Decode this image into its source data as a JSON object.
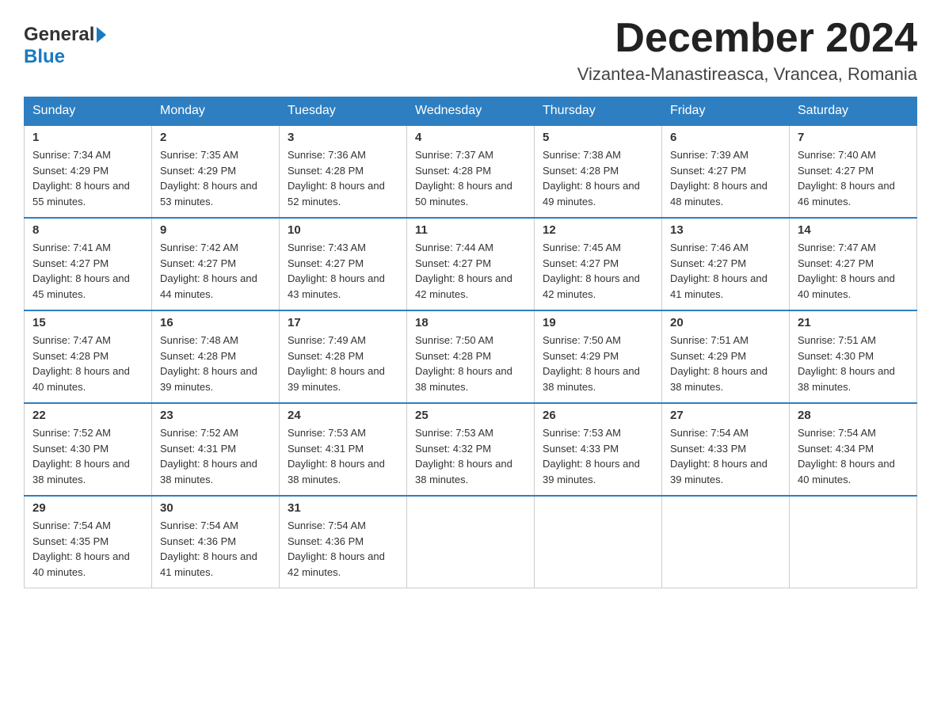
{
  "logo": {
    "general": "General",
    "blue": "Blue"
  },
  "title": "December 2024",
  "subtitle": "Vizantea-Manastireasca, Vrancea, Romania",
  "weekdays": [
    "Sunday",
    "Monday",
    "Tuesday",
    "Wednesday",
    "Thursday",
    "Friday",
    "Saturday"
  ],
  "weeks": [
    [
      {
        "day": "1",
        "sunrise": "7:34 AM",
        "sunset": "4:29 PM",
        "daylight": "8 hours and 55 minutes."
      },
      {
        "day": "2",
        "sunrise": "7:35 AM",
        "sunset": "4:29 PM",
        "daylight": "8 hours and 53 minutes."
      },
      {
        "day": "3",
        "sunrise": "7:36 AM",
        "sunset": "4:28 PM",
        "daylight": "8 hours and 52 minutes."
      },
      {
        "day": "4",
        "sunrise": "7:37 AM",
        "sunset": "4:28 PM",
        "daylight": "8 hours and 50 minutes."
      },
      {
        "day": "5",
        "sunrise": "7:38 AM",
        "sunset": "4:28 PM",
        "daylight": "8 hours and 49 minutes."
      },
      {
        "day": "6",
        "sunrise": "7:39 AM",
        "sunset": "4:27 PM",
        "daylight": "8 hours and 48 minutes."
      },
      {
        "day": "7",
        "sunrise": "7:40 AM",
        "sunset": "4:27 PM",
        "daylight": "8 hours and 46 minutes."
      }
    ],
    [
      {
        "day": "8",
        "sunrise": "7:41 AM",
        "sunset": "4:27 PM",
        "daylight": "8 hours and 45 minutes."
      },
      {
        "day": "9",
        "sunrise": "7:42 AM",
        "sunset": "4:27 PM",
        "daylight": "8 hours and 44 minutes."
      },
      {
        "day": "10",
        "sunrise": "7:43 AM",
        "sunset": "4:27 PM",
        "daylight": "8 hours and 43 minutes."
      },
      {
        "day": "11",
        "sunrise": "7:44 AM",
        "sunset": "4:27 PM",
        "daylight": "8 hours and 42 minutes."
      },
      {
        "day": "12",
        "sunrise": "7:45 AM",
        "sunset": "4:27 PM",
        "daylight": "8 hours and 42 minutes."
      },
      {
        "day": "13",
        "sunrise": "7:46 AM",
        "sunset": "4:27 PM",
        "daylight": "8 hours and 41 minutes."
      },
      {
        "day": "14",
        "sunrise": "7:47 AM",
        "sunset": "4:27 PM",
        "daylight": "8 hours and 40 minutes."
      }
    ],
    [
      {
        "day": "15",
        "sunrise": "7:47 AM",
        "sunset": "4:28 PM",
        "daylight": "8 hours and 40 minutes."
      },
      {
        "day": "16",
        "sunrise": "7:48 AM",
        "sunset": "4:28 PM",
        "daylight": "8 hours and 39 minutes."
      },
      {
        "day": "17",
        "sunrise": "7:49 AM",
        "sunset": "4:28 PM",
        "daylight": "8 hours and 39 minutes."
      },
      {
        "day": "18",
        "sunrise": "7:50 AM",
        "sunset": "4:28 PM",
        "daylight": "8 hours and 38 minutes."
      },
      {
        "day": "19",
        "sunrise": "7:50 AM",
        "sunset": "4:29 PM",
        "daylight": "8 hours and 38 minutes."
      },
      {
        "day": "20",
        "sunrise": "7:51 AM",
        "sunset": "4:29 PM",
        "daylight": "8 hours and 38 minutes."
      },
      {
        "day": "21",
        "sunrise": "7:51 AM",
        "sunset": "4:30 PM",
        "daylight": "8 hours and 38 minutes."
      }
    ],
    [
      {
        "day": "22",
        "sunrise": "7:52 AM",
        "sunset": "4:30 PM",
        "daylight": "8 hours and 38 minutes."
      },
      {
        "day": "23",
        "sunrise": "7:52 AM",
        "sunset": "4:31 PM",
        "daylight": "8 hours and 38 minutes."
      },
      {
        "day": "24",
        "sunrise": "7:53 AM",
        "sunset": "4:31 PM",
        "daylight": "8 hours and 38 minutes."
      },
      {
        "day": "25",
        "sunrise": "7:53 AM",
        "sunset": "4:32 PM",
        "daylight": "8 hours and 38 minutes."
      },
      {
        "day": "26",
        "sunrise": "7:53 AM",
        "sunset": "4:33 PM",
        "daylight": "8 hours and 39 minutes."
      },
      {
        "day": "27",
        "sunrise": "7:54 AM",
        "sunset": "4:33 PM",
        "daylight": "8 hours and 39 minutes."
      },
      {
        "day": "28",
        "sunrise": "7:54 AM",
        "sunset": "4:34 PM",
        "daylight": "8 hours and 40 minutes."
      }
    ],
    [
      {
        "day": "29",
        "sunrise": "7:54 AM",
        "sunset": "4:35 PM",
        "daylight": "8 hours and 40 minutes."
      },
      {
        "day": "30",
        "sunrise": "7:54 AM",
        "sunset": "4:36 PM",
        "daylight": "8 hours and 41 minutes."
      },
      {
        "day": "31",
        "sunrise": "7:54 AM",
        "sunset": "4:36 PM",
        "daylight": "8 hours and 42 minutes."
      },
      null,
      null,
      null,
      null
    ]
  ]
}
